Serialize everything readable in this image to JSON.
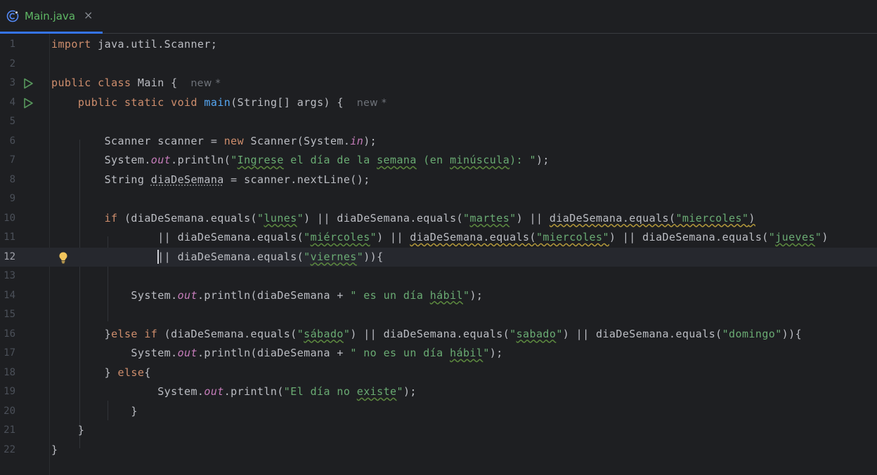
{
  "tab": {
    "filename": "Main.java",
    "close_glyph": "×",
    "icon": "java-class-icon",
    "label_color": "#5fb865",
    "accent": "#3574f0"
  },
  "editor": {
    "current_line": 12,
    "hint_new": "new *",
    "lines": [
      {
        "n": "1"
      },
      {
        "n": "2"
      },
      {
        "n": "3"
      },
      {
        "n": "4"
      },
      {
        "n": "5"
      },
      {
        "n": "6"
      },
      {
        "n": "7"
      },
      {
        "n": "8"
      },
      {
        "n": "9"
      },
      {
        "n": "10"
      },
      {
        "n": "11"
      },
      {
        "n": "12"
      },
      {
        "n": "13"
      },
      {
        "n": "14"
      },
      {
        "n": "15"
      },
      {
        "n": "16"
      },
      {
        "n": "17"
      },
      {
        "n": "18"
      },
      {
        "n": "19"
      },
      {
        "n": "20"
      },
      {
        "n": "21"
      },
      {
        "n": "22"
      }
    ],
    "code": {
      "l1": [
        "import",
        " java.util.Scanner;"
      ],
      "l3": [
        "public",
        " ",
        "class",
        " Main {"
      ],
      "l4": [
        "public",
        " ",
        "static",
        " ",
        "void",
        " ",
        "main",
        "(String[] args) {"
      ],
      "l6": [
        "Scanner scanner = ",
        "new",
        " Scanner(System.",
        "in",
        ");"
      ],
      "l7": [
        "System.",
        "out",
        ".println(",
        "\"",
        "Ingrese",
        " el día de la ",
        "semana",
        " (en ",
        "minúscula",
        "): \"",
        ");"
      ],
      "l8": [
        "String ",
        "diaDeSemana",
        " = scanner.nextLine();"
      ],
      "l10": [
        "if",
        " (diaDeSemana.equals(",
        "\"",
        "lunes",
        "\"",
        ") || diaDeSemana.equals(",
        "\"",
        "martes",
        "\"",
        ") || ",
        "diaDeSemana.equals(",
        "\"miercoles\"",
        ")"
      ],
      "l11": [
        "|| diaDeSemana.equals(",
        "\"",
        "miércoles",
        "\"",
        ") || ",
        "diaDeSemana.equals(",
        "\"miercoles\"",
        ") || diaDeSemana.equals(",
        "\"",
        "jueves",
        "\"",
        ")"
      ],
      "l12": [
        "|| diaDeSemana.equals(",
        "\"",
        "viernes",
        "\"",
        ")){"
      ],
      "l14": [
        "System.",
        "out",
        ".println(diaDeSemana + ",
        "\" es un día ",
        "hábil",
        "\"",
        ");"
      ],
      "l16": [
        "}",
        "else",
        " ",
        "if",
        " (diaDeSemana.equals(",
        "\"",
        "sábado",
        "\"",
        ") || diaDeSemana.equals(",
        "\"",
        "sabado",
        "\"",
        ") || diaDeSemana.equals(",
        "\"domingo\"",
        ")){"
      ],
      "l17": [
        "System.",
        "out",
        ".println(diaDeSemana + ",
        "\" no es un día ",
        "hábil",
        "\"",
        ");"
      ],
      "l18": [
        "} ",
        "else",
        "{"
      ],
      "l19": [
        "System.",
        "out",
        ".println(",
        "\"El día no ",
        "existe",
        "\"",
        ");"
      ],
      "l20": [
        "}"
      ],
      "l21": [
        "}"
      ],
      "l22": [
        "}"
      ]
    }
  },
  "colors": {
    "keyword": "#cf8e6d",
    "string": "#6aab73",
    "static_field": "#c77dbb",
    "method_decl": "#56a8f5",
    "default_text": "#bcbec4",
    "background": "#1e1f22"
  },
  "icons": {
    "run": "run-gutter-icon",
    "bulb": "lightbulb-icon"
  }
}
